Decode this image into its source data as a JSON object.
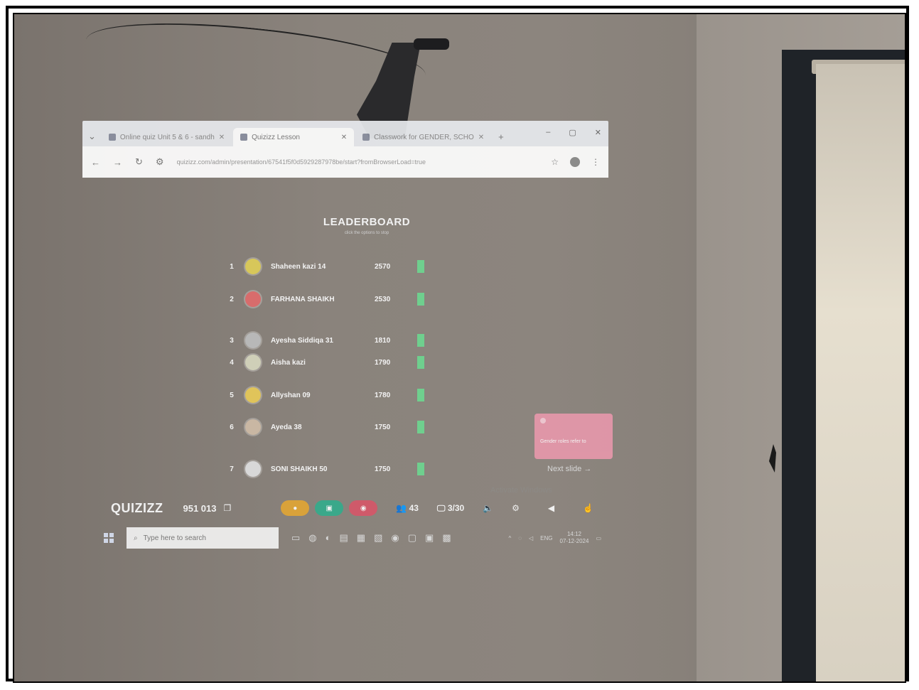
{
  "browser": {
    "tabs": [
      {
        "label": "Online quiz Unit 5 & 6 - sandh",
        "active": false,
        "icon": "mail-icon"
      },
      {
        "label": "Quizizz Lesson",
        "active": true,
        "icon": "quizizz-icon"
      },
      {
        "label": "Classwork for GENDER, SCHO",
        "active": false,
        "icon": "classroom-icon"
      }
    ],
    "new_tab": "+",
    "window_controls": [
      "–",
      "▢",
      "✕"
    ],
    "url": "quizizz.com/admin/presentation/67541f5f0d5929287978be/start?fromBrowserLoad=true"
  },
  "leaderboard": {
    "title": "LEADERBOARD",
    "subtitle": "click the options to stop",
    "rows": [
      {
        "rank": "1",
        "name": "Shaheen kazi 14",
        "score": "2570",
        "avatar_color": "#d7c75a"
      },
      {
        "rank": "2",
        "name": "FARHANA SHAIKH",
        "score": "2530",
        "avatar_color": "#d86c6c"
      },
      {
        "rank": "3",
        "name": "Ayesha Siddiqa 31",
        "score": "1810",
        "avatar_color": "#b8b8b8"
      },
      {
        "rank": "4",
        "name": "Aisha kazi",
        "score": "1790",
        "avatar_color": "#cfcfb8"
      },
      {
        "rank": "5",
        "name": "Allyshan 09",
        "score": "1780",
        "avatar_color": "#e0c45a"
      },
      {
        "rank": "6",
        "name": "Ayeda 38",
        "score": "1750",
        "avatar_color": "#c9b7a3"
      },
      {
        "rank": "7",
        "name": "SONI SHAIKH 50",
        "score": "1750",
        "avatar_color": "#d8d8d8"
      }
    ]
  },
  "next_slide": {
    "card_text": "Gender roles refer to",
    "label": "Next slide",
    "arrow": "→"
  },
  "watermark": "Activate Windows",
  "quizizz_bar": {
    "logo": "QUIZIZZ",
    "code": "951 013",
    "participants": "43",
    "slide_progress": "3/30",
    "pill_colors": [
      "#d9a23a",
      "#3aa88a",
      "#cf5a6a"
    ]
  },
  "taskbar": {
    "search_placeholder": "Type here to search",
    "tray_lang": "ENG",
    "time": "14:12",
    "date": "07-12-2024"
  },
  "colors": {
    "score_bar": "#6fcf8e",
    "next_card": "#e898ac"
  }
}
